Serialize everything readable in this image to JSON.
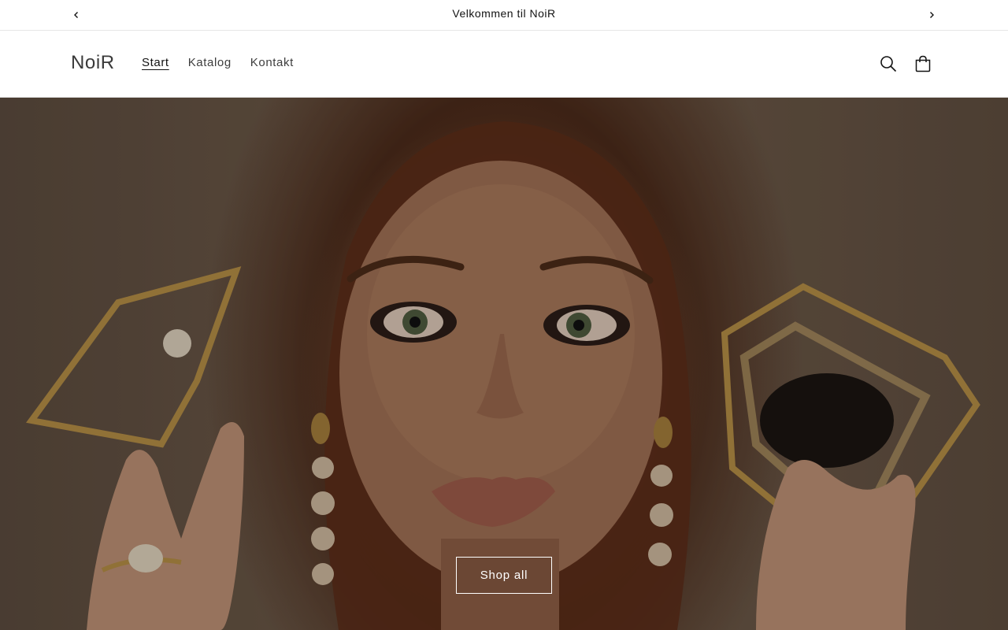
{
  "announcement": {
    "text": "Velkommen til NoiR",
    "prev_icon": "chevron-left-icon",
    "next_icon": "chevron-right-icon"
  },
  "header": {
    "logo": "NoiR",
    "nav": [
      {
        "label": "Start",
        "active": true
      },
      {
        "label": "Katalog",
        "active": false
      },
      {
        "label": "Kontakt",
        "active": false
      }
    ],
    "search_icon": "search-icon",
    "cart_icon": "cart-icon"
  },
  "hero": {
    "button_label": "Shop all"
  }
}
